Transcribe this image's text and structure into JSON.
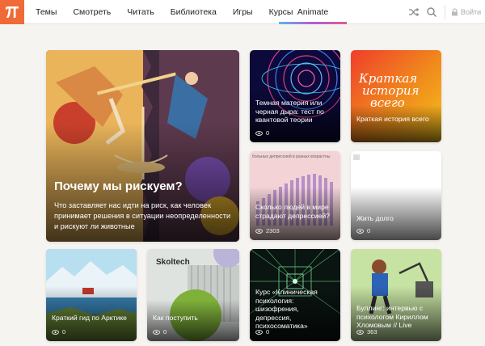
{
  "header": {
    "logo": "П",
    "nav": [
      "Темы",
      "Смотреть",
      "Читать",
      "Библиотека",
      "Игры",
      "Курсы"
    ],
    "animate_tab": "Animate",
    "shuffle_icon": "shuffle-icon",
    "search_icon": "search-icon",
    "lock_icon": "lock-icon",
    "login_label": "Войти",
    "accent_color": "#ef6a36"
  },
  "cards": {
    "big": {
      "title": "Почему мы рискуем?",
      "description": "Что заставляет нас идти на риск, как человек принимает решения в ситуации неопределенности и рискуют ли животные"
    },
    "dark_matter": {
      "title": "Темная материя или черная дыра: тест по квантовой теории",
      "views": "0"
    },
    "history": {
      "art_text": [
        "Краткая",
        "история",
        "всего"
      ],
      "title": "Краткая история всего"
    },
    "depression": {
      "chart_caption": "больных депрессией в разных возрастны",
      "title": "Сколько людей в мире страдают депрессией?",
      "views": "2303"
    },
    "live_long": {
      "title": "Жить долго",
      "views": "0"
    },
    "arctic": {
      "title": "Краткий гид по Арктике",
      "views": "0"
    },
    "skoltech": {
      "logo": "Skoltech",
      "title": "Как поступить",
      "views": "0"
    },
    "psychology": {
      "title": "Курс «Клиническая психология: шизофрения, депрессия, психосоматика»",
      "views": "0"
    },
    "bullying": {
      "title": "Буллинг: интервью с психологом Кириллом Хломовым // Live",
      "views": "363"
    }
  }
}
